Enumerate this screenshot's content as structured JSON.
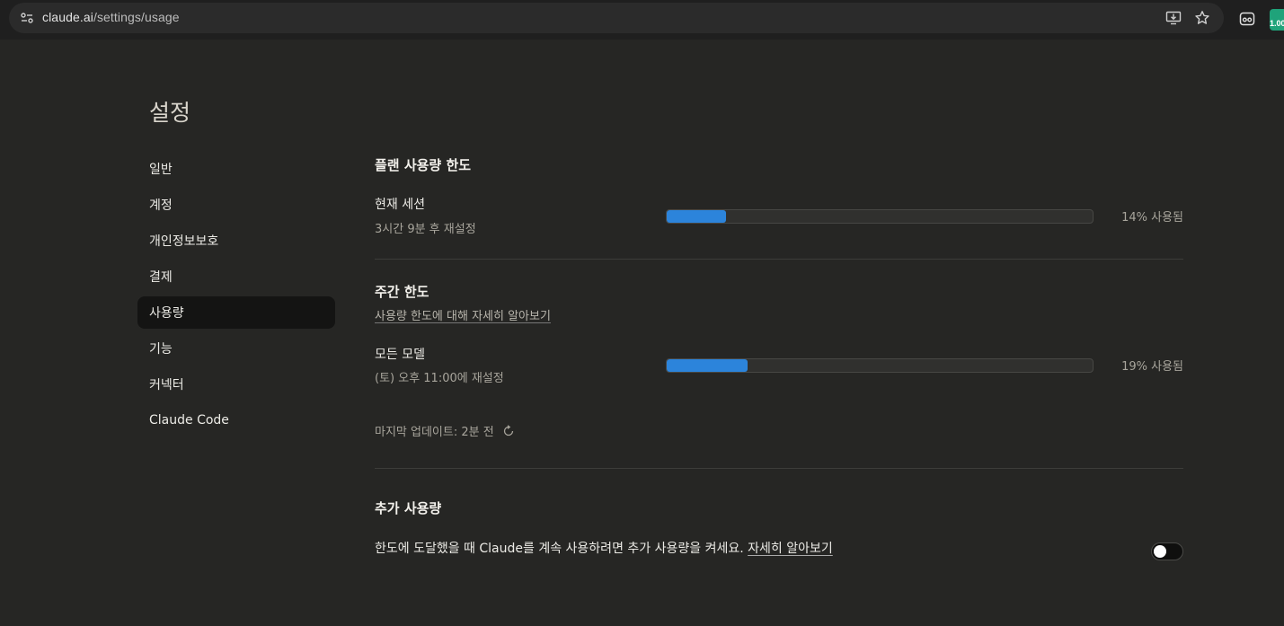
{
  "browser": {
    "url_host": "claude.ai",
    "url_path": "/settings/usage",
    "extension_badge": "1.00"
  },
  "page": {
    "title": "설정"
  },
  "sidebar": {
    "items": [
      {
        "label": "일반",
        "active": false
      },
      {
        "label": "계정",
        "active": false
      },
      {
        "label": "개인정보보호",
        "active": false
      },
      {
        "label": "결제",
        "active": false
      },
      {
        "label": "사용량",
        "active": true
      },
      {
        "label": "기능",
        "active": false
      },
      {
        "label": "커넥터",
        "active": false
      },
      {
        "label": "Claude Code",
        "active": false
      }
    ]
  },
  "plan_limits": {
    "title": "플랜 사용량 한도",
    "current_session": {
      "label": "현재 세션",
      "reset": "3시간 9분 후 재설정",
      "percent_used": 14,
      "used_text": "14% 사용됨"
    }
  },
  "weekly_limits": {
    "title": "주간 한도",
    "learn_more": "사용량 한도에 대해 자세히 알아보기",
    "all_models": {
      "label": "모든 모델",
      "reset": "(토) 오후 11:00에 재설정",
      "percent_used": 19,
      "used_text": "19% 사용됨"
    },
    "last_updated": "마지막 업데이트: 2분 전"
  },
  "extra_usage": {
    "title": "추가 사용량",
    "description": "한도에 도달했을 때 Claude를 계속 사용하려면 추가 사용량을 켜세요. ",
    "learn_more": "자세히 알아보기",
    "enabled": false
  },
  "colors": {
    "background": "#262624",
    "progress_fill": "#2c84db",
    "active_nav": "#141413"
  }
}
